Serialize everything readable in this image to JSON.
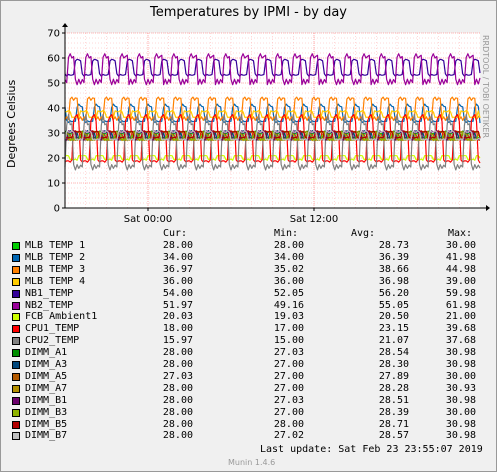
{
  "chart_data": {
    "type": "line",
    "title": "Temperatures by IPMI - by day",
    "ylabel": "Degrees Celsius",
    "xlabel": "",
    "side_text": "RRDTOOL / TOBI OETIKER",
    "ylim": [
      0,
      70
    ],
    "yticks": [
      "0",
      "10",
      "20",
      "30",
      "40",
      "50",
      "60",
      "70"
    ],
    "xticks": [
      {
        "label": "Sat 00:00",
        "pos": 0.2
      },
      {
        "label": "Sat 12:00",
        "pos": 0.6
      }
    ],
    "grid": true,
    "columns": [
      "Cur:",
      "Min:",
      "Avg:",
      "Max:"
    ],
    "series": [
      {
        "name": "MLB TEMP 1",
        "color": "#00cc00",
        "cur": "28.00",
        "min": "28.00",
        "avg": "28.73",
        "max": "30.00"
      },
      {
        "name": "MLB TEMP 2",
        "color": "#0066b3",
        "cur": "34.00",
        "min": "34.00",
        "avg": "36.39",
        "max": "41.98"
      },
      {
        "name": "MLB TEMP 3",
        "color": "#ff8000",
        "cur": "36.97",
        "min": "35.02",
        "avg": "38.66",
        "max": "44.98"
      },
      {
        "name": "MLB TEMP 4",
        "color": "#ffcc00",
        "cur": "36.00",
        "min": "36.00",
        "avg": "36.98",
        "max": "39.00"
      },
      {
        "name": "NB1_TEMP",
        "color": "#330099",
        "cur": "54.00",
        "min": "52.05",
        "avg": "56.20",
        "max": "59.98"
      },
      {
        "name": "NB2_TEMP",
        "color": "#990099",
        "cur": "51.97",
        "min": "49.16",
        "avg": "55.05",
        "max": "61.98"
      },
      {
        "name": "FCB Ambient1",
        "color": "#ccff00",
        "cur": "20.03",
        "min": "19.03",
        "avg": "20.50",
        "max": "21.00"
      },
      {
        "name": "CPU1_TEMP",
        "color": "#ff0000",
        "cur": "18.00",
        "min": "17.00",
        "avg": "23.15",
        "max": "39.68"
      },
      {
        "name": "CPU2_TEMP",
        "color": "#808080",
        "cur": "15.97",
        "min": "15.00",
        "avg": "21.07",
        "max": "37.68"
      },
      {
        "name": "DIMM_A1",
        "color": "#008f00",
        "cur": "28.00",
        "min": "27.03",
        "avg": "28.54",
        "max": "30.98"
      },
      {
        "name": "DIMM_A3",
        "color": "#00487d",
        "cur": "28.00",
        "min": "27.00",
        "avg": "28.30",
        "max": "30.98"
      },
      {
        "name": "DIMM_A5",
        "color": "#b35a00",
        "cur": "27.03",
        "min": "27.00",
        "avg": "27.89",
        "max": "30.00"
      },
      {
        "name": "DIMM_A7",
        "color": "#b38f00",
        "cur": "28.00",
        "min": "27.00",
        "avg": "28.28",
        "max": "30.93"
      },
      {
        "name": "DIMM_B1",
        "color": "#6b006b",
        "cur": "28.00",
        "min": "27.03",
        "avg": "28.51",
        "max": "30.98"
      },
      {
        "name": "DIMM_B3",
        "color": "#8fb300",
        "cur": "28.00",
        "min": "27.00",
        "avg": "28.39",
        "max": "30.00"
      },
      {
        "name": "DIMM_B5",
        "color": "#b30000",
        "cur": "28.00",
        "min": "28.00",
        "avg": "28.71",
        "max": "30.98"
      },
      {
        "name": "DIMM_B7",
        "color": "#bebebe",
        "cur": "28.00",
        "min": "27.02",
        "avg": "28.57",
        "max": "30.98"
      }
    ],
    "last_update": "Last update:  Sat Feb 23 23:55:07 2019",
    "version": "Munin 1.4.6"
  }
}
